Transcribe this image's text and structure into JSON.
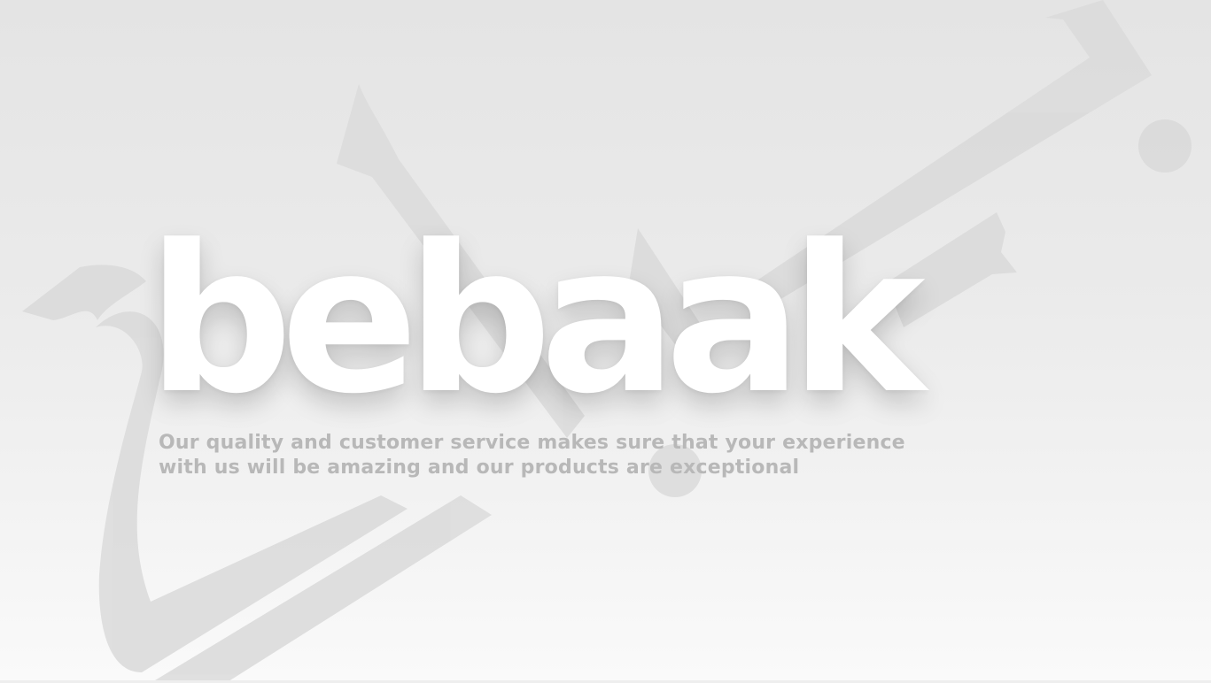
{
  "brand": {
    "name": "bebaak",
    "tagline": "Our quality and customer service makes sure that your experience with us will be amazing and our products are exceptional"
  },
  "background": {
    "ornament": "calligraphy-ornament"
  },
  "colors": {
    "background_top": "#e4e4e4",
    "background_bottom": "#fafafa",
    "ornament": "#dadada",
    "wordmark": "#ffffff",
    "tagline": "#b8b8b8"
  }
}
